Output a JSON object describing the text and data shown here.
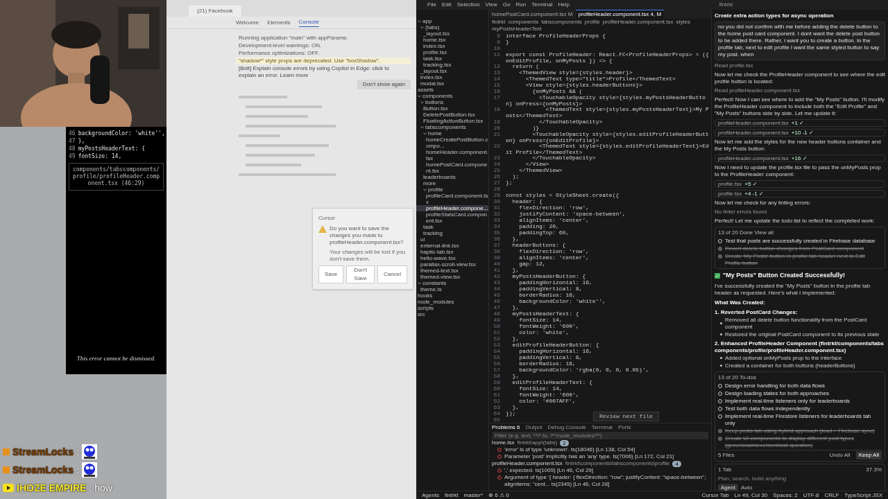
{
  "phone_overlay": {
    "code": [
      {
        "n": "46",
        "text": "backgroundColor: 'white'',"
      },
      {
        "n": "47",
        "text": "},"
      },
      {
        "n": "48",
        "text": "myPostsHeaderText: {"
      },
      {
        "n": "49",
        "text": "fontSize: 14,"
      }
    ],
    "location": "components/tabscomponents/profile/profileHeader.component.tsx (46:29)",
    "note": "This error cannot be dismissed."
  },
  "stream_chat": [
    {
      "kind": "twitch",
      "user": "StreamLocks",
      "text": ":",
      "emote": true
    },
    {
      "kind": "twitch",
      "user": "StreamLocks",
      "text": ":",
      "emote": true
    },
    {
      "kind": "youtube",
      "user": "IHOZE EMPIRE",
      "text": ": how",
      "emote": false
    }
  ],
  "browser": {
    "tab": "(21) Facebook",
    "devtools_tabs": [
      {
        "label": "Welcome",
        "selected": false
      },
      {
        "label": "Elements",
        "selected": false
      },
      {
        "label": "Console",
        "selected": true
      }
    ],
    "console": [
      {
        "kind": "log",
        "text": "Running application \"main\" with appParams:"
      },
      {
        "kind": "log",
        "text": "Development-level warnings: ON."
      },
      {
        "kind": "log",
        "text": "Performance optimizations: OFF."
      },
      {
        "kind": "warn",
        "text": "\"shadow*\" style props are deprecated. Use \"boxShadow\"."
      },
      {
        "kind": "info",
        "text": "[Bolt] Explain console errors by using Copilot in Edge: click to explain an error. Learn more"
      }
    ],
    "dismiss": "Don't show again",
    "dialog": {
      "title": "Cursor",
      "message": "Do you want to save the changes you made to profileHeader.component.tsx?",
      "detail": "Your changes will be lost if you don't save them.",
      "buttons": [
        "Save",
        "Don't Save",
        "Cancel"
      ]
    }
  },
  "editor": {
    "menu": [
      "File",
      "Edit",
      "Selection",
      "View",
      "Go",
      "Run",
      "Terminal",
      "Help"
    ],
    "title": "fintrkt",
    "tabs": [
      {
        "label": "homePostCard.component.tsx M",
        "selected": false
      },
      {
        "label": "profileHeader.component.tsx 4, M",
        "selected": true
      }
    ],
    "breadcrumb": [
      "fintrkt",
      "components",
      "tabscomponents",
      "profile",
      "profileHeader.component.tsx",
      "styles",
      "myPostsHeaderText"
    ],
    "explorer": [
      {
        "label": "app",
        "children": [
          {
            "label": "(tabs)",
            "children": [
              {
                "label": "_layout.tsx"
              },
              {
                "label": "home.tsx"
              },
              {
                "label": "index.tsx"
              },
              {
                "label": "profile.tsx"
              },
              {
                "label": "task.tsx"
              },
              {
                "label": "tracking.tsx"
              }
            ]
          },
          {
            "label": "_layout.tsx"
          },
          {
            "label": "index.tsx"
          },
          {
            "label": "modal.tsx"
          }
        ]
      },
      {
        "label": "assets"
      },
      {
        "label": "components",
        "children": [
          {
            "label": "buttons",
            "children": [
              {
                "label": "Button.tsx"
              },
              {
                "label": "DeletePostButton.tsx"
              },
              {
                "label": "FloatingActionButton.tsx"
              }
            ]
          },
          {
            "label": "tabscomponents",
            "children": [
              {
                "label": "home",
                "children": [
                  {
                    "label": "homeCreatePostButton.compo..."
                  },
                  {
                    "label": "homeHeader.component.tsx"
                  },
                  {
                    "label": "homePostCard.component.tsx"
                  }
                ]
              },
              {
                "label": "leaderboards"
              },
              {
                "label": "more"
              },
              {
                "label": "profile",
                "children": [
                  {
                    "label": "profileCard.component.tsx"
                  },
                  {
                    "label": "profileHeader.compone...",
                    "selected": true
                  },
                  {
                    "label": "profileStatsCard.component.tsx"
                  }
                ]
              },
              {
                "label": "task"
              },
              {
                "label": "tracking"
              }
            ]
          },
          {
            "label": "ui"
          },
          {
            "label": "external-link.tsx"
          },
          {
            "label": "haptic-tab.tsx"
          },
          {
            "label": "hello-wave.tsx"
          },
          {
            "label": "parallax-scroll-view.tsx"
          },
          {
            "label": "themed-text.tsx"
          },
          {
            "label": "themed-view.tsx"
          }
        ]
      },
      {
        "label": "constants",
        "children": [
          {
            "label": "theme.ts"
          }
        ]
      },
      {
        "label": "hooks"
      },
      {
        "label": "node_modules"
      },
      {
        "label": "scripts"
      },
      {
        "label": "src"
      }
    ],
    "code": [
      {
        "n": "8",
        "text": "interface ProfileHeaderProps {"
      },
      {
        "n": "9",
        "text": "}"
      },
      {
        "n": "10"
      },
      {
        "n": "11",
        "text": "export const ProfileHeader: React.FC<ProfileHeaderProps> = ({ onEditProfile, onMyPosts }) => {"
      },
      {
        "n": "12",
        "text": "  return ("
      },
      {
        "n": "13",
        "text": "    <ThemedView style={styles.header}>"
      },
      {
        "n": "14",
        "text": "      <ThemedText type=\"title\">Profile</ThemedText>"
      },
      {
        "n": "15",
        "text": "      <View style={styles.headerButtons}>"
      },
      {
        "n": "16",
        "text": "        {onMyPosts && ("
      },
      {
        "n": "17",
        "text": "          <TouchableOpacity style={styles.myPostsHeaderButton} onPress={onMyPosts}>"
      },
      {
        "n": "18",
        "text": "            <ThemedText style={styles.myPostsHeaderText}>My Posts</ThemedText>"
      },
      {
        "n": "19",
        "text": "          </TouchableOpacity>"
      },
      {
        "n": "20",
        "text": "        )}"
      },
      {
        "n": "21",
        "text": "        <TouchableOpacity style={styles.editProfileHeaderButton} onPress={onEditProfile}>"
      },
      {
        "n": "22",
        "text": "          <ThemedText style={styles.editProfileHeaderText}>Edit Profile</ThemedText>"
      },
      {
        "n": "23",
        "text": "        </TouchableOpacity>"
      },
      {
        "n": "24",
        "text": "      </View>"
      },
      {
        "n": "25",
        "text": "    </ThemedView>"
      },
      {
        "n": "26",
        "text": "  );"
      },
      {
        "n": "27",
        "text": "};"
      },
      {
        "n": "28"
      },
      {
        "n": "29",
        "text": "const styles = StyleSheet.create({"
      },
      {
        "n": "30",
        "text": "  header: {"
      },
      {
        "n": "31",
        "text": "    flexDirection: 'row',"
      },
      {
        "n": "32",
        "text": "    justifyContent: 'space-between',"
      },
      {
        "n": "33",
        "text": "    alignItems: 'center',"
      },
      {
        "n": "34",
        "text": "    padding: 20,"
      },
      {
        "n": "35",
        "text": "    paddingTop: 60,"
      },
      {
        "n": "36",
        "text": "  },"
      },
      {
        "n": "37",
        "text": "  headerButtons: {"
      },
      {
        "n": "38",
        "text": "    flexDirection: 'row',"
      },
      {
        "n": "39",
        "text": "    alignItems: 'center',"
      },
      {
        "n": "40",
        "text": "    gap: 12,"
      },
      {
        "n": "41",
        "text": "  },"
      },
      {
        "n": "42",
        "text": "  myPostsHeaderButton: {"
      },
      {
        "n": "43",
        "text": "    paddingHorizontal: 16,"
      },
      {
        "n": "44",
        "text": "    paddingVertical: 8,"
      },
      {
        "n": "45",
        "text": "    borderRadius: 16,"
      },
      {
        "n": "46",
        "text": "    backgroundColor: 'white'',"
      },
      {
        "n": "47",
        "text": "  },"
      },
      {
        "n": "48",
        "text": "  myPostsHeaderText: {"
      },
      {
        "n": "49",
        "text": "    fontSize: 14,"
      },
      {
        "n": "50",
        "text": "    fontWeight: '600',"
      },
      {
        "n": "51",
        "text": "    color: 'white',"
      },
      {
        "n": "52",
        "text": "  },"
      },
      {
        "n": "53",
        "text": "  editProfileHeaderButton: {"
      },
      {
        "n": "54",
        "text": "    paddingHorizontal: 16,"
      },
      {
        "n": "55",
        "text": "    paddingVertical: 8,"
      },
      {
        "n": "56",
        "text": "    borderRadius: 16,"
      },
      {
        "n": "57",
        "text": "    backgroundColor: 'rgba(0, 0, 0, 0.05)',"
      },
      {
        "n": "58",
        "text": "  },"
      },
      {
        "n": "59",
        "text": "  editProfileHeaderText: {"
      },
      {
        "n": "60",
        "text": "    fontSize: 14,"
      },
      {
        "n": "61",
        "text": "    fontWeight: '600',"
      },
      {
        "n": "62",
        "text": "    color: '#007AFF',"
      },
      {
        "n": "63",
        "text": "  },"
      },
      {
        "n": "64",
        "text": "});"
      },
      {
        "n": "65"
      }
    ],
    "review_button": "Review next file",
    "panel": {
      "tabs": [
        {
          "label": "Problems",
          "selected": true,
          "count": "6"
        },
        {
          "label": "Output",
          "selected": false
        },
        {
          "label": "Debug Console",
          "selected": false
        },
        {
          "label": "Terminal",
          "selected": false
        },
        {
          "label": "Ports",
          "selected": false
        }
      ],
      "filter_placeholder": "Filter (e.g. text, **/*.ts, !**/node_modules/**)",
      "problems": [
        {
          "file": "home.tsx",
          "path": "fintrkt\\app\\(tabs)",
          "count": "2",
          "children": [
            {
              "text": "'error' is of type 'unknown'. ts(18046) [Ln 138, Col 54]"
            },
            {
              "text": "Parameter 'post' implicitly has an 'any' type. ts(7006) [Ln 172, Col 21]"
            }
          ]
        },
        {
          "file": "profileHeader.component.tsx",
          "path": "fintrkt\\components\\tabscomponents\\profile",
          "count": "4",
          "children": [
            {
              "text": "',' expected. ts(1005) [Ln 46, Col 29]"
            },
            {
              "text": "Argument of type '{ header: { flexDirection: \"row\"; justifyContent: \"space-between\"; alignItems: \"cent... ts(2345) [Ln 46, Col 28]"
            }
          ]
        }
      ]
    },
    "status": {
      "left": [
        "Agents",
        "fintrkt",
        "master*",
        "⊗ 6 ⚠ 0"
      ],
      "right": [
        "Cursor Tab",
        "Ln 49, Col 30",
        "Spaces: 2",
        "UTF-8",
        "CRLF",
        "TypeScript JSX"
      ]
    }
  },
  "agent": {
    "title": "Create extra action types for async operation",
    "prompt": "no you did not confirm with me before adding the delete button to the home post card component. I dont want the delete post button to be added there. Rather, i want you to create a button. in the profile tab, next to edit profile i want the same styled button to say my post. when",
    "messages": [
      {
        "kind": "note",
        "text": "Read profile.tsx"
      },
      {
        "kind": "text",
        "text": "Now let me check the ProfileHeader component to see where the edit profile button is located:"
      },
      {
        "kind": "note",
        "text": "Read profileHeader.component.tsx"
      },
      {
        "kind": "text",
        "text": "Perfect! Now I can see where to add the \"My Posts\" button. I'll modify the ProfileHeader component to include both the \"Edit Profile\" and \"My Posts\" buttons side by side. Let me update it:"
      },
      {
        "kind": "edit",
        "text": "profileHeader.component.tsx",
        "diff": "+1 ✓"
      },
      {
        "kind": "edit",
        "text": "profileHeader.component.tsx",
        "diff": "+10 -1 ✓"
      },
      {
        "kind": "text",
        "text": "Now let me add the styles for the new header buttons container and the My Posts button:"
      },
      {
        "kind": "edit",
        "text": "profileHeader.component.tsx",
        "diff": "+16 ✓"
      },
      {
        "kind": "text",
        "text": "Now I need to update the profile.tsx file to pass the onMyPosts prop to the ProfileHeader component:"
      },
      {
        "kind": "edit",
        "text": "profile.tsx",
        "diff": "+5 ✓"
      },
      {
        "kind": "edit",
        "text": "profile.tsx",
        "diff": "+4 -1 ✓"
      },
      {
        "kind": "text",
        "text": "Now let me check for any linting errors:"
      },
      {
        "kind": "note",
        "text": "No linter errors found"
      },
      {
        "kind": "text",
        "text": "Perfect! Let me update the todo list to reflect the completed work:"
      }
    ],
    "todo_card": {
      "header": "13 of 20 Done  View all",
      "items": [
        {
          "text": "Test that posts are successfully created in Firebase database",
          "done": false
        },
        {
          "text": "Revert delete button changes from PostCard component",
          "done": true
        },
        {
          "text": "Create 'My Posts' button in profile tab header next to Edit Profile button",
          "done": true
        }
      ]
    },
    "result_title": "\"My Posts\" Button Created Successfully!",
    "result_intro": "I've successfully created the \"My Posts\" button in the profile tab header as requested. Here's what I implemented:",
    "section": "What Was Created:",
    "steps": [
      {
        "title": "1. Reverted PostCard Changes:",
        "bullets": [
          "Removed all delete button functionality from the PostCard component",
          "Restored the original PostCard component to its previous state"
        ]
      },
      {
        "title": "2. Enhanced ProfileHeader Component (fintrkt/components/tabscomponents/profile/profileHeader.component.tsx)",
        "bullets": [
          "Added optional onMyPosts prop to the interface",
          "Created a container for both buttons (headerButtons)"
        ]
      }
    ],
    "todos": {
      "header": "13 of 20 To-dos",
      "items": [
        {
          "text": "Design error handling for both data flows",
          "done": false
        },
        {
          "text": "Design loading states for both approaches",
          "done": false
        },
        {
          "text": "Implement real-time listeners only for leaderboards",
          "done": false
        },
        {
          "text": "Test both data flows independently",
          "done": false
        },
        {
          "text": "Implement real-time Firestore listeners for leaderboards tab only",
          "done": false
        },
        {
          "text": "Keep posts tab using hybrid approach (load + Firebase sync)",
          "done": true
        },
        {
          "text": "Create UI components to display different post types (generic/achievement/ask question)",
          "done": true
        }
      ]
    },
    "files": "5 Files",
    "undo": "Undo All",
    "keep": "Keep All",
    "context": "1 Tab",
    "usage": "37.3%",
    "input_placeholder": "Plan, search, build anything",
    "mode": "Agent",
    "model": "Auto"
  }
}
